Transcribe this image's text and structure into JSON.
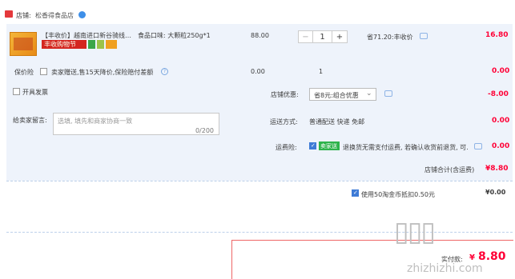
{
  "shop": {
    "label": "店铺:",
    "name": "松香得食品店"
  },
  "item": {
    "title": "【丰收价】越南进口新谷骑线…",
    "attr": "食品口味: 大颗粒250g*1",
    "tag_text": "丰收购物节",
    "unit_price": "88.00",
    "quantity": "1",
    "save_text": "省71.20:丰收价",
    "subtotal": "16.80"
  },
  "service": {
    "label": "保价险",
    "text": "卖家赠送,售15天降价,保险赔付差额",
    "price": "0.00",
    "qty": "1",
    "total": "0.00"
  },
  "invoice": {
    "label": "开具发票"
  },
  "coupon": {
    "label": "店铺优惠:",
    "selected": "省8元:组合优惠",
    "amount": "-8.00"
  },
  "message": {
    "label": "给卖家留言:",
    "placeholder": "选填, 填先和商家协商一致",
    "counter": "0/200"
  },
  "delivery": {
    "label": "运送方式:",
    "value": "普通配送 快递 免邮",
    "amount": "0.00"
  },
  "insurance": {
    "label": "运费险:",
    "tag": "卖家送",
    "text": "退换货无需支付运费, 若确认收货前退货, 可...",
    "amount": "0.00"
  },
  "shop_total": {
    "label": "店铺合计(含运费)",
    "amount": "¥8.80"
  },
  "points": {
    "text": "使用50淘金币抵扣0.50元",
    "amount": "¥0.00"
  },
  "final": {
    "label": "实付款:",
    "currency": "¥",
    "amount": "8.80"
  },
  "watermark": {
    "text": "zhizhizhi.com"
  },
  "colors": {
    "accent_red": "#ff0036",
    "panel_blue": "#eef3fb",
    "link_blue": "#3e7bd6"
  }
}
